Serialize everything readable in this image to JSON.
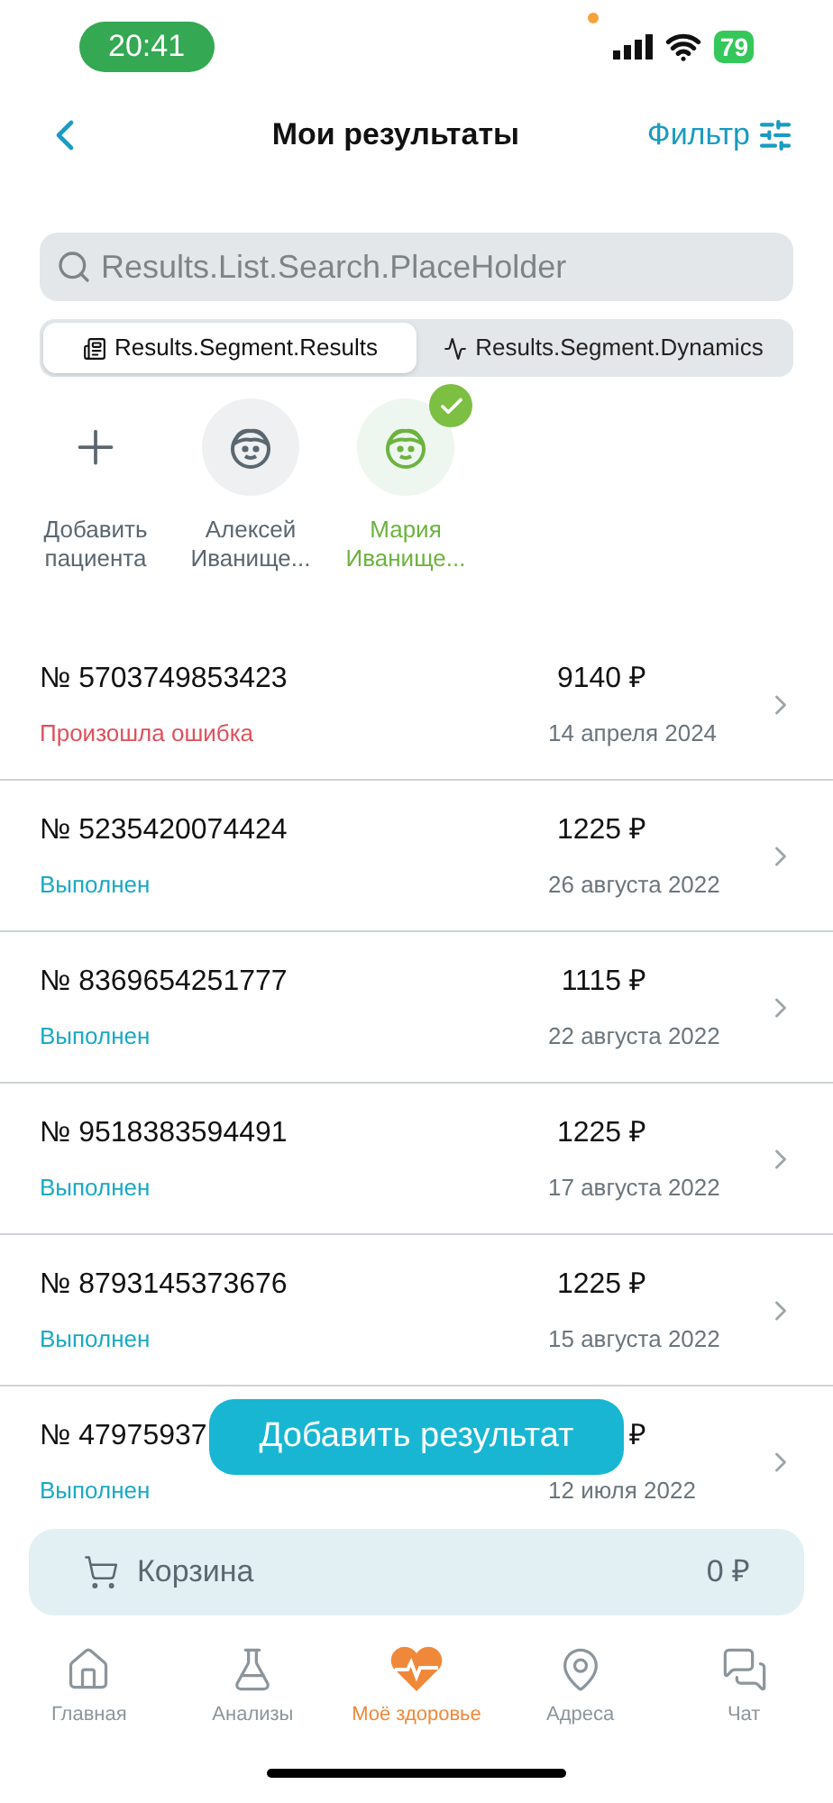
{
  "status_bar": {
    "time": "20:41",
    "battery": "79"
  },
  "header": {
    "title": "Мои результаты",
    "filter": "Фильтр"
  },
  "search": {
    "placeholder": "Results.List.Search.PlaceHolder"
  },
  "segments": [
    {
      "label": "Results.Segment.Results",
      "selected": true,
      "kind": "list"
    },
    {
      "label": "Results.Segment.Dynamics",
      "selected": false,
      "kind": "pulse"
    }
  ],
  "patients": [
    {
      "kind": "add",
      "name": "Добавить пациента",
      "selected": false
    },
    {
      "kind": "person",
      "name": "Алексей Иванище...",
      "selected": false
    },
    {
      "kind": "person",
      "name": "Мария Иванище...",
      "selected": true
    }
  ],
  "orders": [
    {
      "number": "№ 5703749853423",
      "status": "Произошла ошибка",
      "kind": "error",
      "price": "9140 ₽",
      "date": "14 апреля 2024"
    },
    {
      "number": "№ 5235420074424",
      "status": "Выполнен",
      "kind": "done",
      "price": "1225 ₽",
      "date": "26 августа 2022"
    },
    {
      "number": "№ 8369654251777",
      "status": "Выполнен",
      "kind": "done",
      "price": "1115 ₽",
      "date": "22 августа 2022"
    },
    {
      "number": "№ 9518383594491",
      "status": "Выполнен",
      "kind": "done",
      "price": "1225 ₽",
      "date": "17 августа 2022"
    },
    {
      "number": "№ 8793145373676",
      "status": "Выполнен",
      "kind": "done",
      "price": "1225 ₽",
      "date": "15 августа 2022"
    },
    {
      "number": "№ 47975937",
      "status": "Выполнен",
      "kind": "done",
      "price": "₽",
      "date": "12 июля 2022"
    }
  ],
  "add_button": "Добавить результат",
  "cart": {
    "label": "Корзина",
    "total": "0 ₽"
  },
  "tab_bar": [
    {
      "label": "Главная",
      "kind": "home",
      "selected": false
    },
    {
      "label": "Анализы",
      "kind": "flask",
      "selected": false
    },
    {
      "label": "Моё здоровье",
      "kind": "heart",
      "selected": true
    },
    {
      "label": "Адреса",
      "kind": "pin",
      "selected": false
    },
    {
      "label": "Чат",
      "kind": "chat",
      "selected": false
    }
  ]
}
